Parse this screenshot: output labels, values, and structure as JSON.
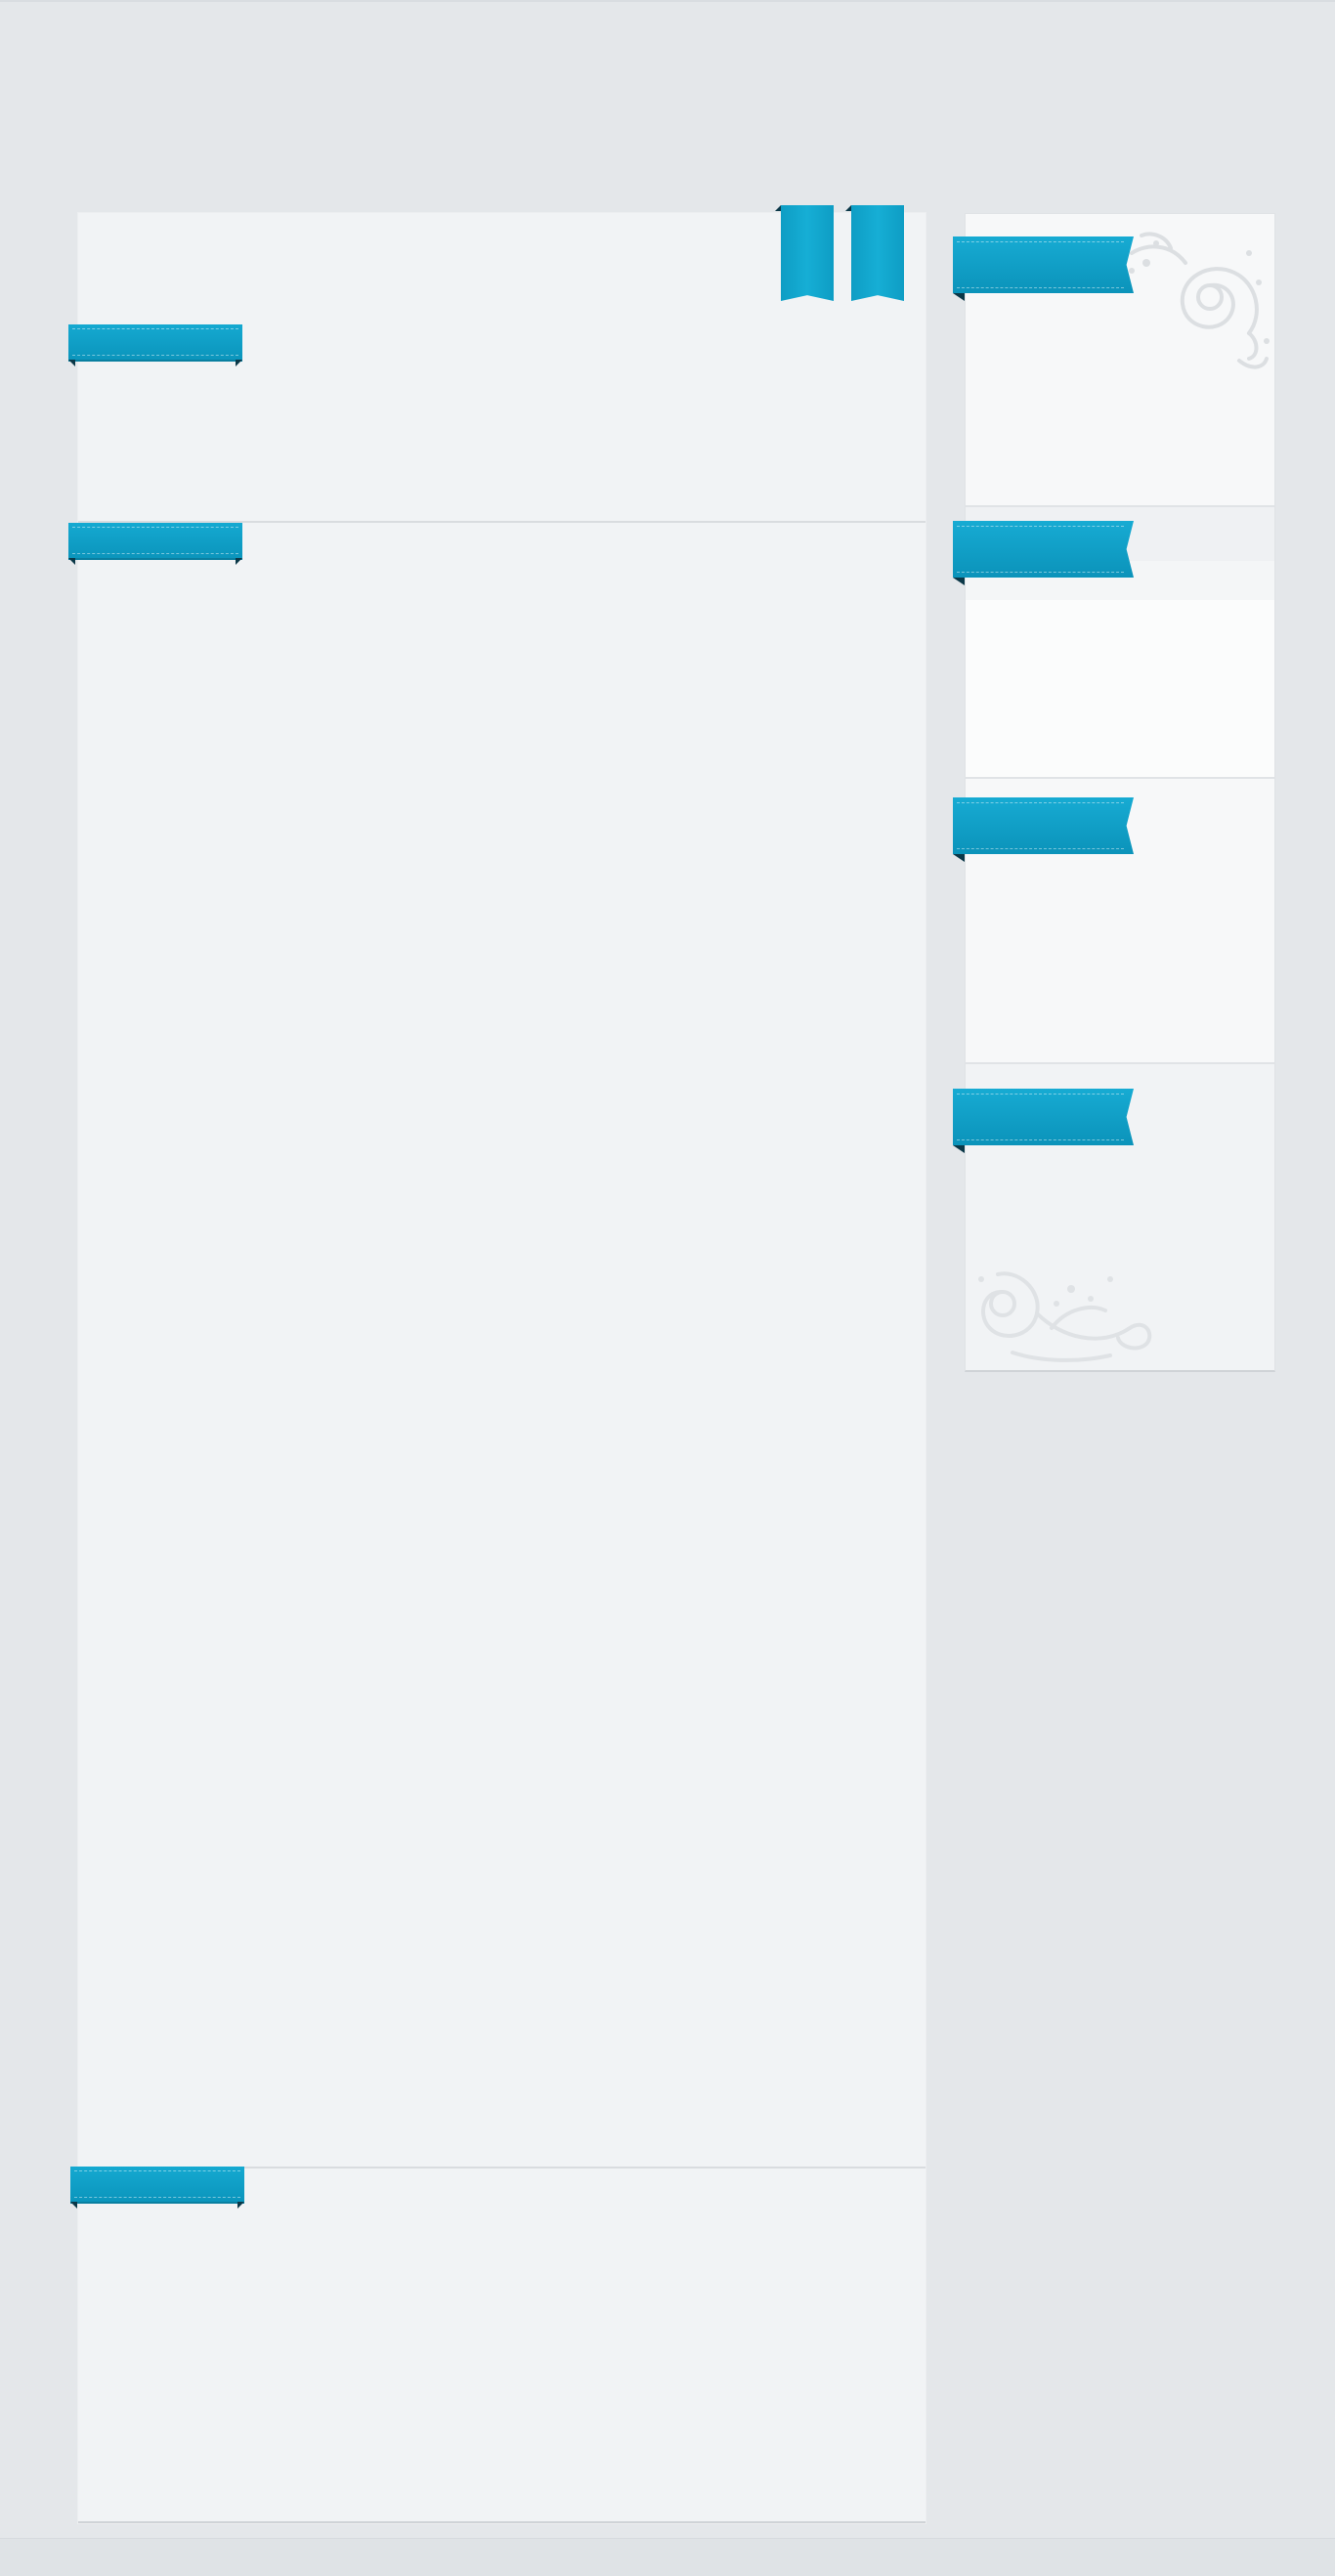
{
  "page": {
    "background": "#e4e7ea",
    "card_background": "#f1f3f5",
    "accent": "#0e9dc4"
  },
  "main": {
    "sections": [
      {
        "heading": ""
      },
      {
        "heading": ""
      },
      {
        "heading": ""
      }
    ],
    "bookmarks": [
      {
        "label": ""
      },
      {
        "label": ""
      }
    ]
  },
  "sidebar": {
    "widgets": [
      {
        "heading": ""
      },
      {
        "heading": ""
      },
      {
        "heading": ""
      },
      {
        "heading": ""
      }
    ],
    "ornaments": [
      "swirl-ornament-top-right",
      "swirl-ornament-bottom-left"
    ]
  }
}
